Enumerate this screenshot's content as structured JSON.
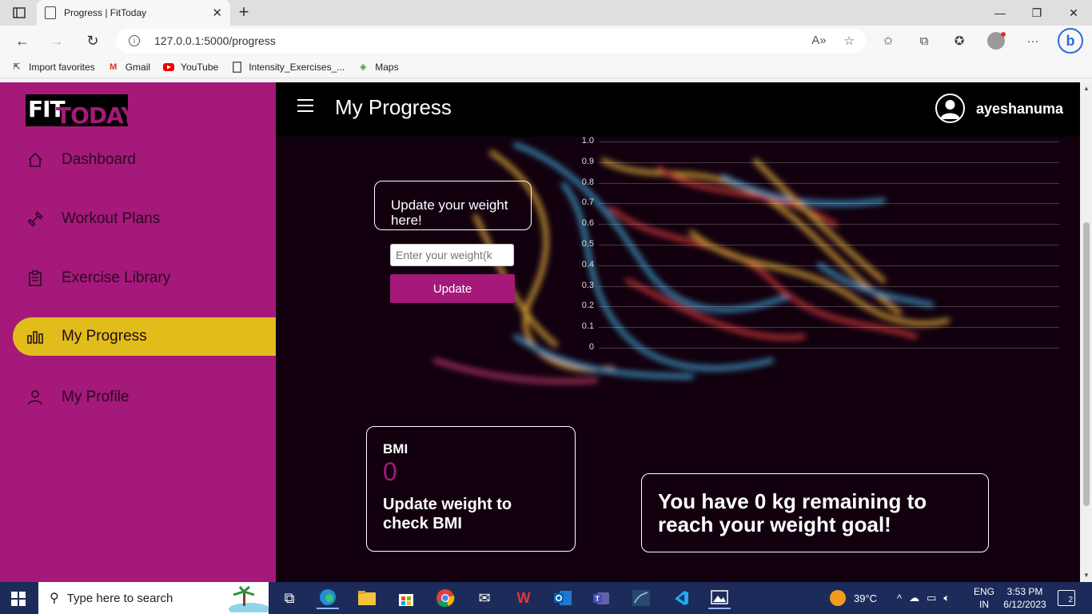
{
  "browser": {
    "tab_title": "Progress | FitToday",
    "url": "127.0.0.1:5000/progress",
    "favorites": [
      {
        "label": "Import favorites",
        "icon": "import-icon"
      },
      {
        "label": "Gmail",
        "icon": "gmail-icon"
      },
      {
        "label": "YouTube",
        "icon": "youtube-icon"
      },
      {
        "label": "Intensity_Exercises_...",
        "icon": "page-icon"
      },
      {
        "label": "Maps",
        "icon": "maps-icon"
      }
    ]
  },
  "logo": {
    "part1": "FIT",
    "part2": "TODAY"
  },
  "sidebar": {
    "items": [
      {
        "label": "Dashboard",
        "icon": "home-icon"
      },
      {
        "label": "Workout Plans",
        "icon": "dumbbell-icon"
      },
      {
        "label": "Exercise Library",
        "icon": "clipboard-icon"
      },
      {
        "label": "My Progress",
        "icon": "bar-chart-icon",
        "active": true
      },
      {
        "label": "My Profile",
        "icon": "user-icon"
      }
    ]
  },
  "header": {
    "title": "My Progress",
    "username": "ayeshanuma"
  },
  "weight_form": {
    "heading": "Update your weight here!",
    "placeholder": "Enter your weight(k",
    "button_label": "Update"
  },
  "chart_data": {
    "type": "line",
    "y_ticks": [
      "1.0",
      "0.9",
      "0.8",
      "0.7",
      "0.6",
      "0.5",
      "0.4",
      "0.3",
      "0.2",
      "0.1",
      "0"
    ],
    "ylim": [
      0,
      1
    ],
    "series": [],
    "grid": true
  },
  "bmi": {
    "label": "BMI",
    "value": "0",
    "message": "Update weight to check BMI"
  },
  "goal": {
    "message": "You have 0 kg remaining to reach your weight goal!"
  },
  "taskbar": {
    "search_placeholder": "Type here to search",
    "weather": "39°C",
    "lang_top": "ENG",
    "lang_bottom": "IN",
    "time": "3:53 PM",
    "date": "6/12/2023",
    "notifications": "2"
  },
  "colors": {
    "brand": "#a5197a",
    "active_nav": "#e1bd1b",
    "topbar": "#000000"
  }
}
